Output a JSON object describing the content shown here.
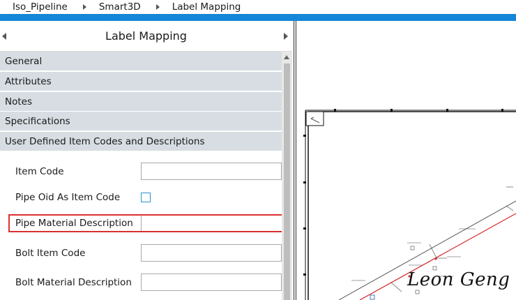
{
  "breadcrumb": [
    "Iso_Pipeline",
    "Smart3D",
    "Label Mapping"
  ],
  "panel": {
    "title": "Label Mapping"
  },
  "sections": [
    "General",
    "Attributes",
    "Notes",
    "Specifications",
    "User Defined Item Codes and Descriptions"
  ],
  "fields": {
    "item_code": {
      "label": "Item Code",
      "value": ""
    },
    "pipe_oid": {
      "label": "Pipe Oid As Item Code",
      "checked": false
    },
    "pipe_material_description": {
      "label": "Pipe Material Description",
      "value": ""
    },
    "bolt_item_code": {
      "label": "Bolt Item Code",
      "value": ""
    },
    "bolt_material_description": {
      "label": "Bolt Material Description",
      "value": ""
    }
  },
  "watermark": "Leon Geng",
  "colors": {
    "accent": "#1586d8",
    "highlight": "#d9302f",
    "section_bg": "#d7dde3",
    "pipe_line": "#d42020"
  }
}
